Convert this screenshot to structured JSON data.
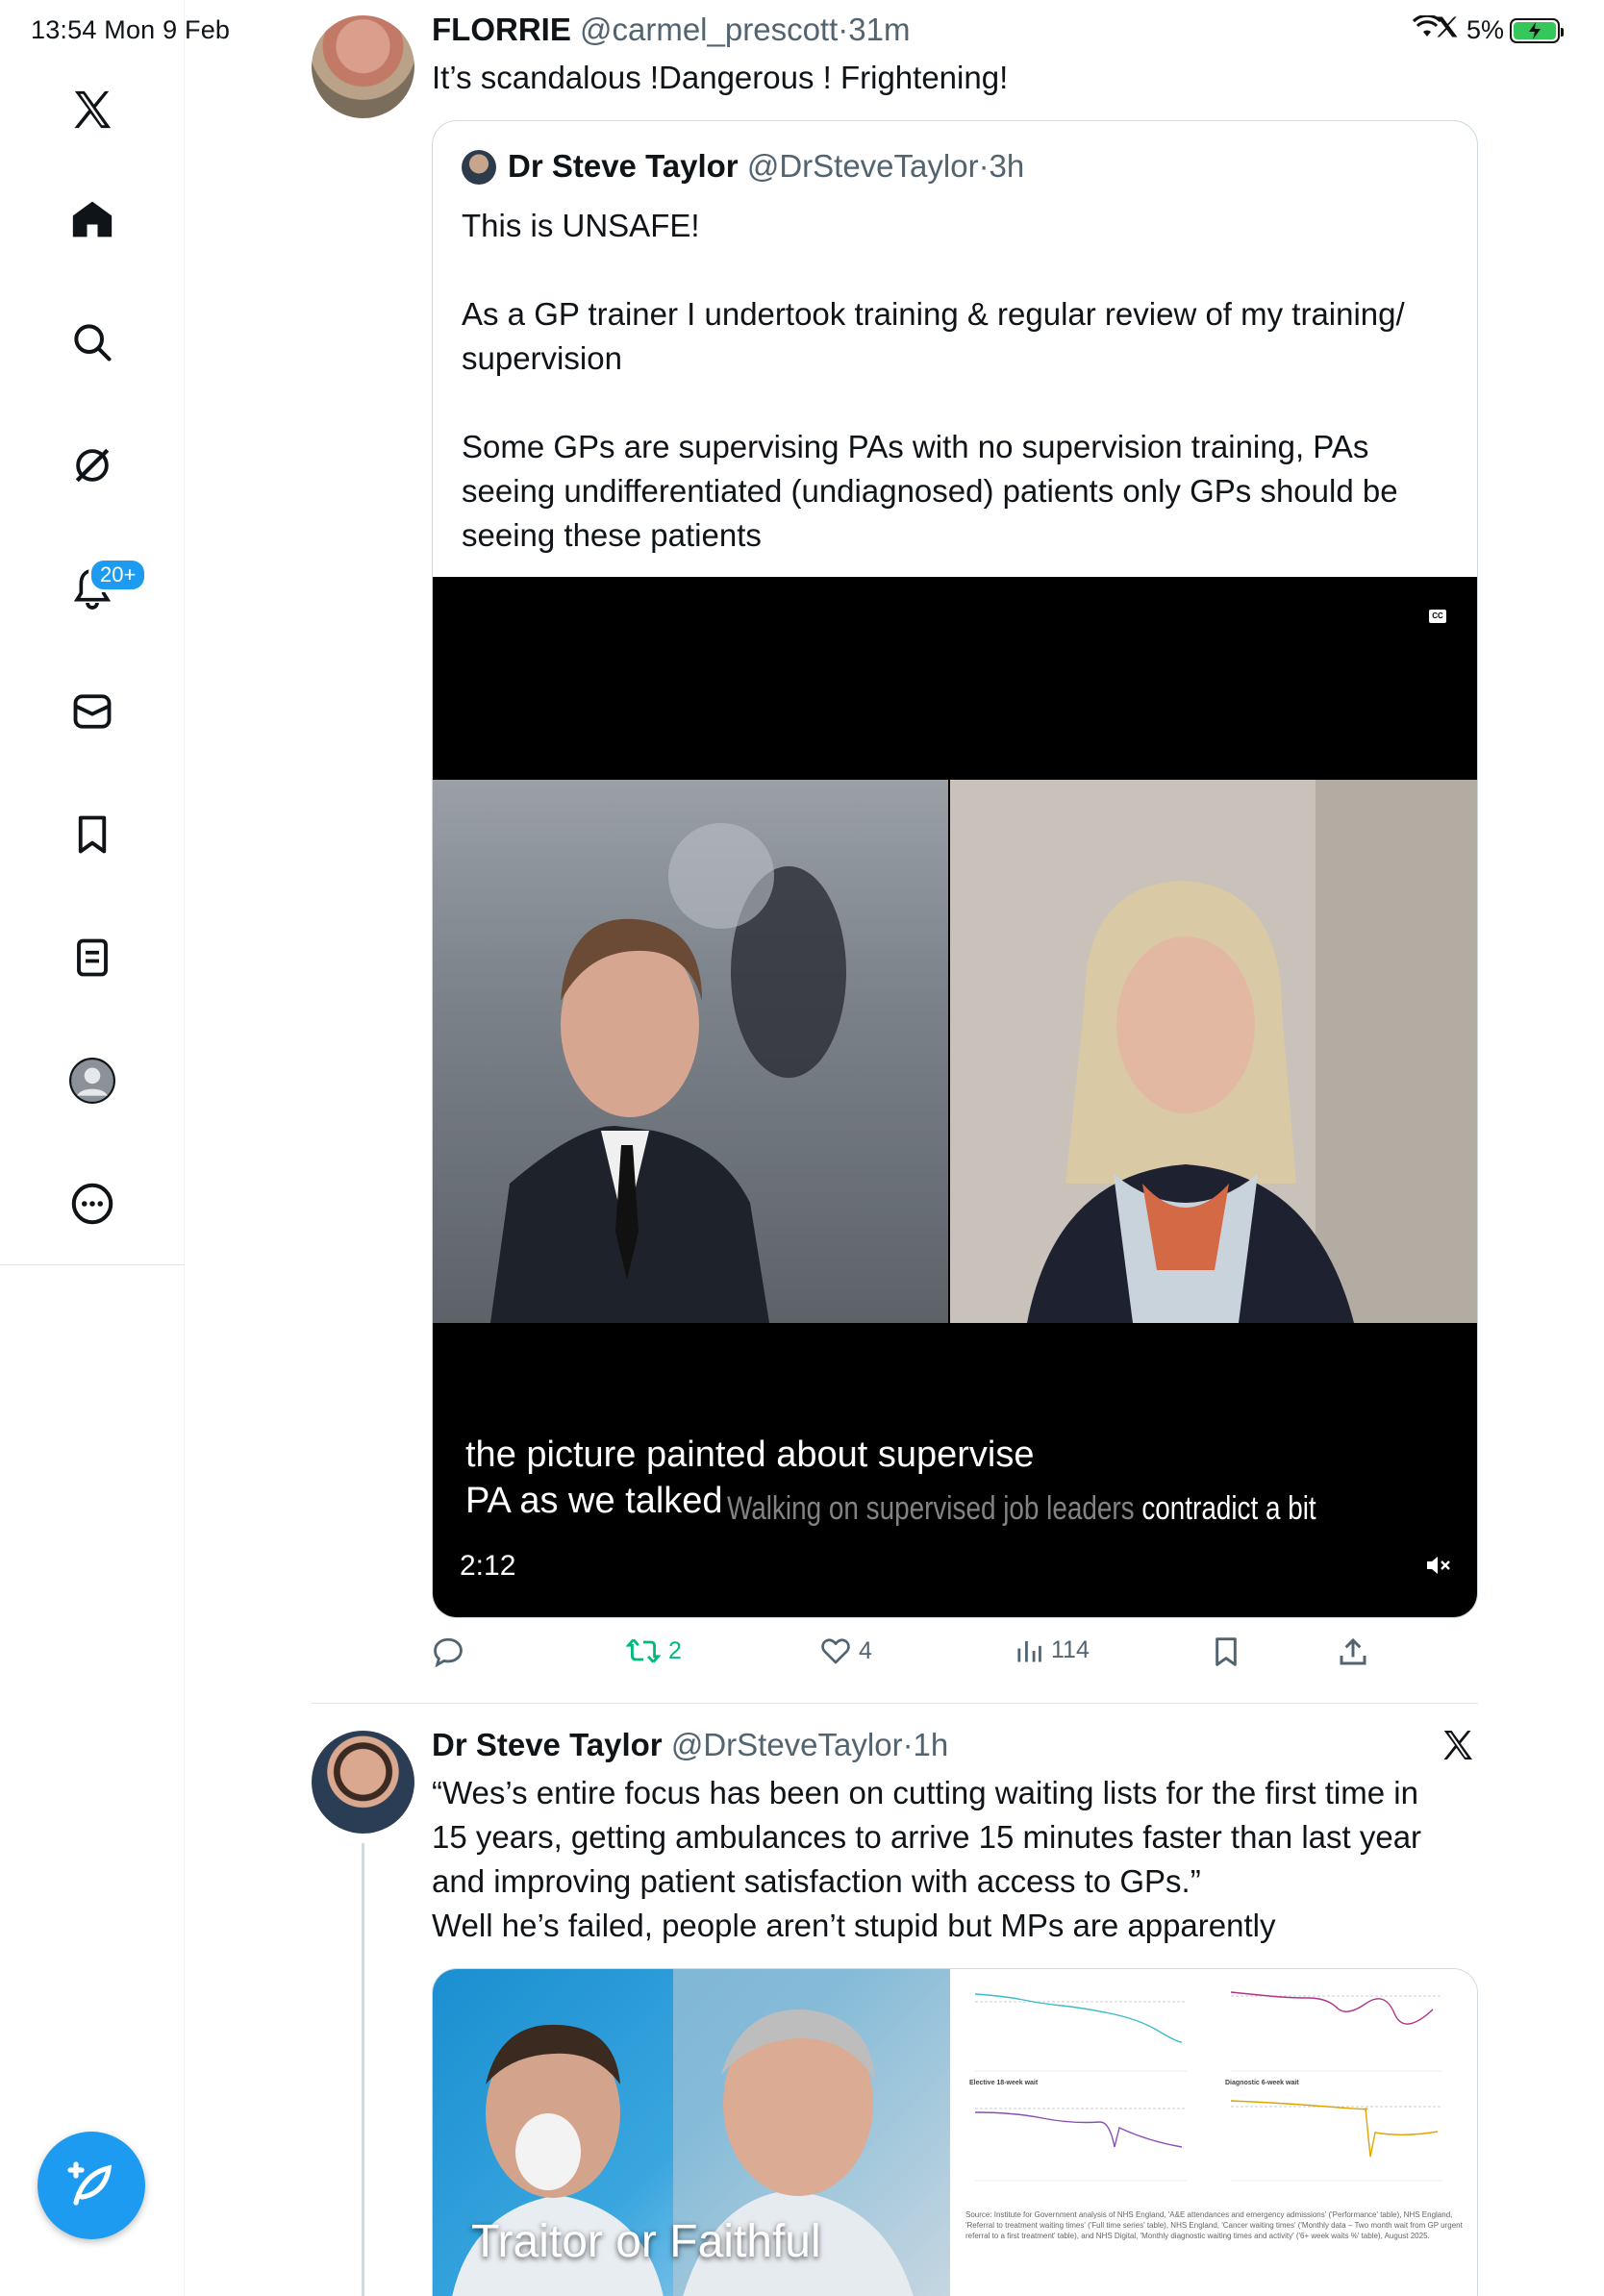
{
  "status_bar": {
    "time_date": "13:54  Mon 9 Feb",
    "battery": "5%"
  },
  "sidebar": {
    "notifications_badge": "20+",
    "items": [
      "x-logo",
      "home",
      "search",
      "grok",
      "notifications",
      "messages",
      "bookmarks",
      "lists",
      "profile",
      "more"
    ]
  },
  "tweet1": {
    "name": "FLORRIE",
    "handle": "@carmel_prescott",
    "time": "·31m",
    "text": "It’s scandalous !Dangerous ! Frightening!",
    "quote": {
      "name": "Dr Steve Taylor",
      "handle": "@DrSteveTaylor",
      "time": "·3h",
      "lines": [
        "This is UNSAFE!",
        "",
        "As a GP trainer I undertook training  & regular review of my training/ supervision",
        "",
        "Some GPs are supervising PAs with no supervision training, PAs seeing undifferentiated (undiagnosed) patients only GPs should be seeing these patients"
      ],
      "video": {
        "cc_label": "CC",
        "caption_line1": "the picture painted about supervise",
        "caption_line2": "PA as we talked",
        "burned_caption_faded": "Walking on supervised job leaders",
        "burned_caption_bright": "contradict a bit",
        "duration": "2:12"
      }
    },
    "actions": {
      "replies": "",
      "reposts": "2",
      "likes": "4",
      "views": "114"
    }
  },
  "tweet2": {
    "name": "Dr Steve Taylor",
    "handle": "@DrSteveTaylor",
    "time": "·1h",
    "text_lines": [
      "“Wes’s entire focus has been on cutting waiting lists for the first time in",
      "15 years, getting ambulances to arrive 15 minutes faster than last year",
      "and improving patient satisfaction with access to GPs.”",
      "Well he’s failed, people aren’t stupid but MPs are apparently"
    ],
    "media": {
      "left_caption": "Traitor or Faithful",
      "chart_labels": [
        "Elective 18-week wait",
        "Diagnostic 6-week wait"
      ],
      "source_note": "Source: Institute for Government analysis of NHS England, 'A&E attendances and emergency admissions' ('Performance' table), NHS England, 'Referral to treatment waiting times' ('Full time series' table), NHS England, 'Cancer waiting times' ('Monthly data – Two month wait from GP urgent referral to a first treatment' table), and NHS Digital, 'Monthly diagnostic waiting times and activity' ('6+ week waits %' table), August 2025."
    }
  },
  "colors": {
    "accent": "#1d9bf0",
    "repost_green": "#00ba7c",
    "text": "#0f1419",
    "muted": "#536471"
  }
}
